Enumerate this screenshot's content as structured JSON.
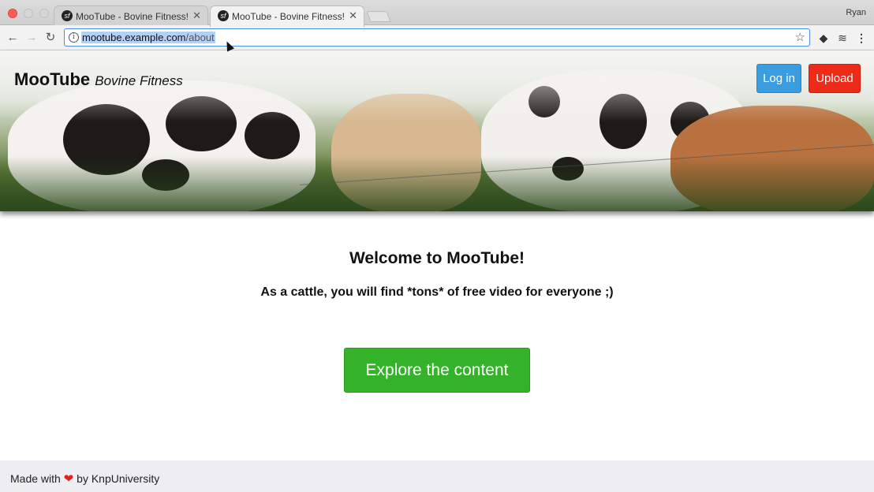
{
  "browser": {
    "tabs": [
      {
        "title": "MooTube - Bovine Fitness!",
        "favicon": "symfony-icon",
        "close": "✕"
      },
      {
        "title": "MooTube - Bovine Fitness!",
        "favicon": "symfony-icon",
        "close": "✕"
      }
    ],
    "profile_name": "Ryan",
    "url_host": "mootube.example.com",
    "url_path": "/about",
    "icons": {
      "back": "←",
      "forward": "→",
      "reload": "↻",
      "info": "i",
      "star": "☆",
      "ext1": "◆",
      "ext2": "≋",
      "menu": "⋮"
    }
  },
  "header": {
    "brand_name": "MooTube",
    "brand_tagline": "Bovine Fitness",
    "login_label": "Log in",
    "upload_label": "Upload",
    "login_color": "#3a9de0",
    "upload_color": "#ee2a18"
  },
  "main": {
    "welcome": "Welcome to MooTube!",
    "subtitle": "As a cattle, you will find *tons* of free video for everyone ;)",
    "cta_label": "Explore the content",
    "cta_color": "#34b32a"
  },
  "footer": {
    "prefix": "Made with",
    "heart": "❤",
    "suffix": "by KnpUniversity"
  }
}
